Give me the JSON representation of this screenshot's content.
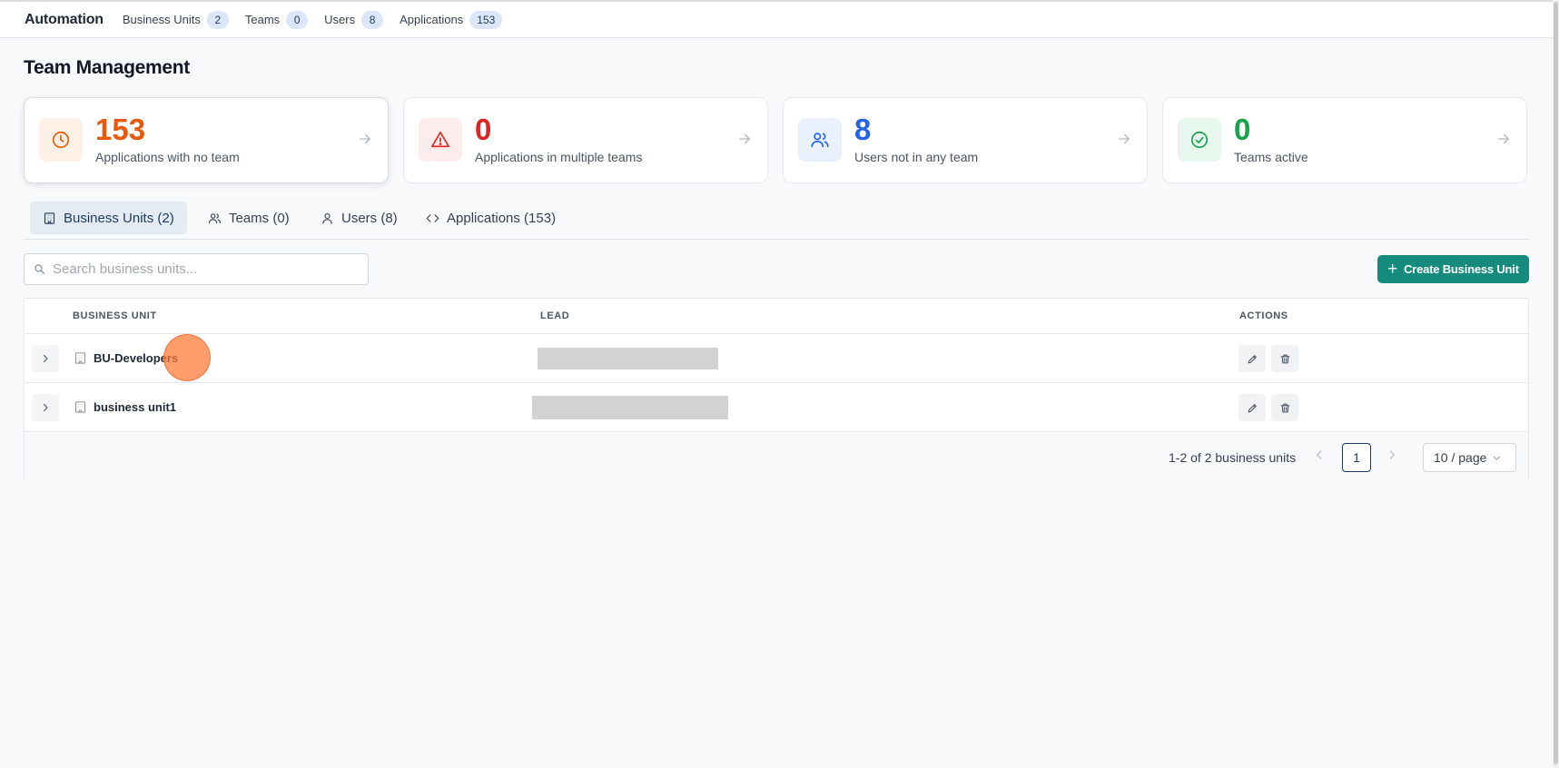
{
  "topbar": {
    "brand": "Automation",
    "items": [
      {
        "label": "Business Units",
        "count": "2"
      },
      {
        "label": "Teams",
        "count": "0"
      },
      {
        "label": "Users",
        "count": "8"
      },
      {
        "label": "Applications",
        "count": "153"
      }
    ]
  },
  "page": {
    "title": "Team Management"
  },
  "cards": [
    {
      "value": "153",
      "label": "Applications with no team",
      "color": "#e8590c",
      "icon": "clock-icon"
    },
    {
      "value": "0",
      "label": "Applications in multiple teams",
      "color": "#dc2626",
      "icon": "warning-icon"
    },
    {
      "value": "8",
      "label": "Users not in any team",
      "color": "#2563eb",
      "icon": "users-icon"
    },
    {
      "value": "0",
      "label": "Teams active",
      "color": "#16a34a",
      "icon": "check-circle-icon"
    }
  ],
  "tabs": [
    {
      "label": "Business Units (2)",
      "icon": "building-icon"
    },
    {
      "label": "Teams (0)",
      "icon": "users-icon"
    },
    {
      "label": "Users (8)",
      "icon": "user-icon"
    },
    {
      "label": "Applications (153)",
      "icon": "code-icon"
    }
  ],
  "search": {
    "placeholder": "Search business units...",
    "value": ""
  },
  "create_button": {
    "label": "Create Business Unit"
  },
  "table": {
    "columns": [
      "BUSINESS UNIT",
      "LEAD",
      "ACTIONS"
    ],
    "rows": [
      {
        "name": "BU-Developers",
        "lead": ""
      },
      {
        "name": "business unit1",
        "lead": ""
      }
    ]
  },
  "pagination": {
    "info": "1-2 of 2 business units",
    "current_page": "1",
    "per_page": "10 / page"
  },
  "colors": {
    "accent": "#148b7d",
    "active_tab_bg": "#e4ebf2",
    "badge_bg": "#dbe7f8"
  }
}
